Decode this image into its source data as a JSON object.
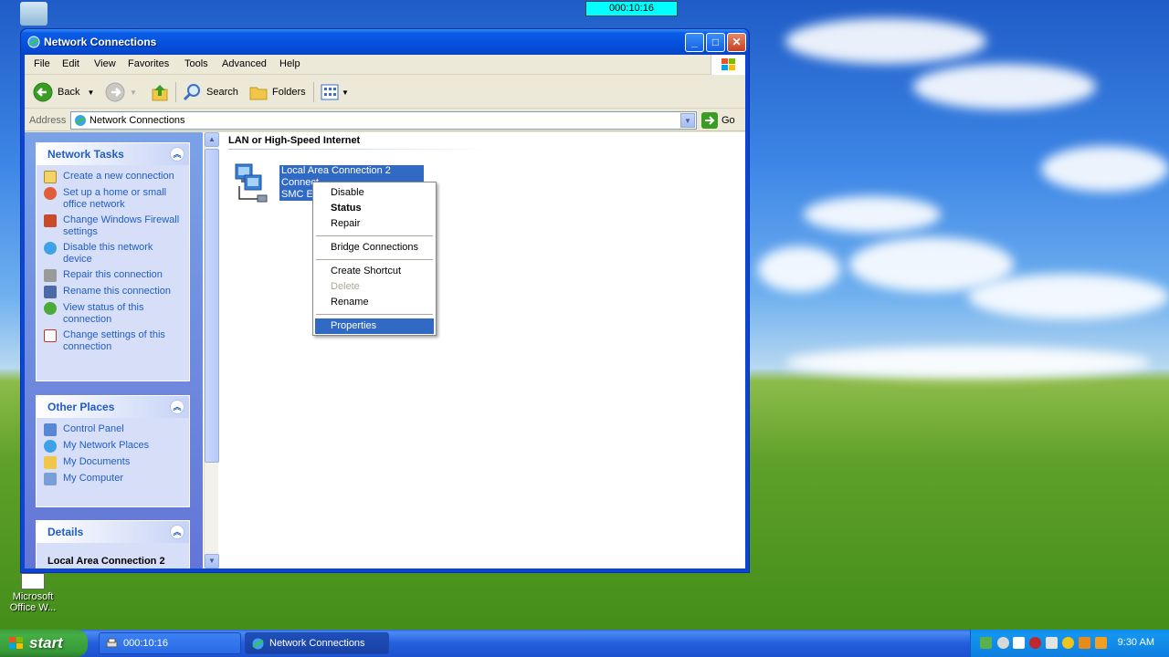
{
  "timer": "000:10:16",
  "window": {
    "title": "Network Connections",
    "controls": {
      "minimize": "_",
      "maximize": "□",
      "close": "✕"
    }
  },
  "menu": [
    "File",
    "Edit",
    "View",
    "Favorites",
    "Tools",
    "Advanced",
    "Help"
  ],
  "toolbar": {
    "back": "Back",
    "search": "Search",
    "folders": "Folders"
  },
  "address": {
    "label": "Address",
    "value": "Network Connections",
    "go": "Go"
  },
  "network_tasks": {
    "title": "Network Tasks",
    "items": [
      "Create a new connection",
      "Set up a home or small office network",
      "Change Windows Firewall settings",
      "Disable this network device",
      "Repair this connection",
      "Rename this connection",
      "View status of this connection",
      "Change settings of this connection"
    ]
  },
  "other_places": {
    "title": "Other Places",
    "items": [
      "Control Panel",
      "My Network Places",
      "My Documents",
      "My Computer"
    ]
  },
  "details": {
    "title": "Details",
    "name": "Local Area Connection 2"
  },
  "section": {
    "title": "LAN or High-Speed Internet"
  },
  "connection": {
    "line1": "Local Area Connection 2",
    "line2": "Connect",
    "line3": "SMC EZ"
  },
  "context_menu": {
    "disable": "Disable",
    "status": "Status",
    "repair": "Repair",
    "bridge": "Bridge Connections",
    "shortcut": "Create Shortcut",
    "delete": "Delete",
    "rename": "Rename",
    "properties": "Properties"
  },
  "taskbar": {
    "start": "start",
    "tasks": [
      "000:10:16",
      "Network Connections"
    ],
    "clock": "9:30 AM"
  },
  "desktop": {
    "office_label": "Microsoft Office W..."
  }
}
